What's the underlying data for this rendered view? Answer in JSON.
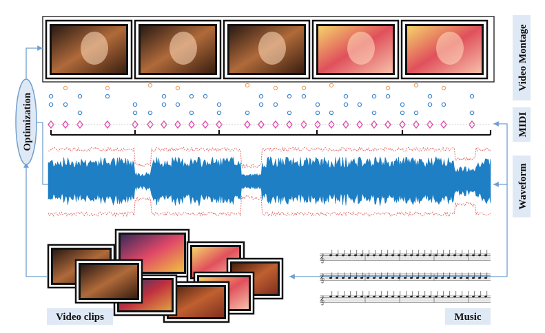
{
  "labels": {
    "video_montage": "Video Montage",
    "midi": "MIDI",
    "waveform": "Waveform",
    "optimization": "Optimization",
    "video_clips": "Video clips",
    "music": "Music"
  },
  "colors": {
    "arrow": "#6f9fcf",
    "midi_orange": "#f0a060",
    "midi_blue": "#3f86d0",
    "midi_pink": "#e04aa8",
    "waveform": "#1f7fc4",
    "envelope": "#e06060",
    "label_bg": "#dfe9f5"
  },
  "montage_frames": [
    "girl-close-up",
    "girl-close-up",
    "girl-close-up",
    "toy-figures",
    "toy-figures"
  ],
  "clip_thumbnails": [
    "girl-portrait",
    "carnival-stage",
    "crowd-scene",
    "toy-figures",
    "girl-portrait",
    "stage-performance",
    "crowd-scene",
    "girl-smiling"
  ]
}
